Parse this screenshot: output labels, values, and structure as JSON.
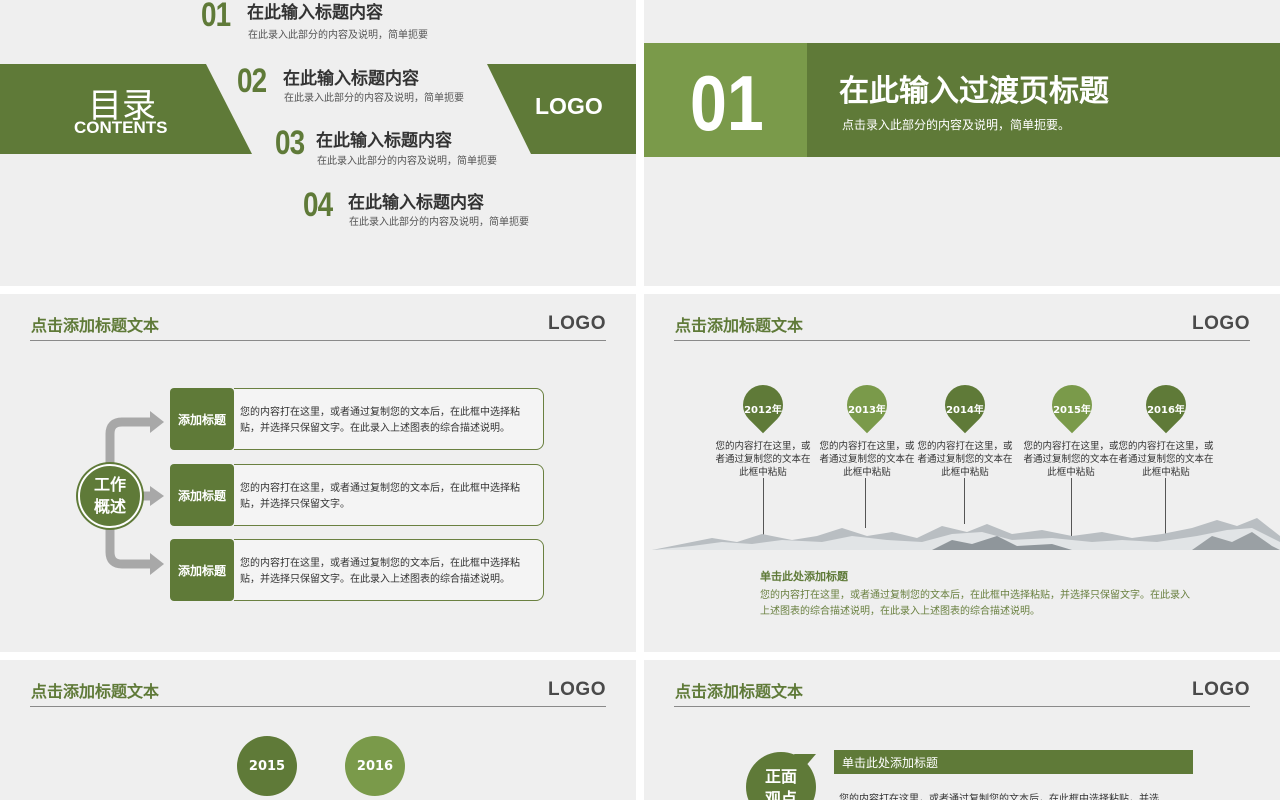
{
  "slide1": {
    "toc_main": "目录",
    "toc_sub": "CONTENTS",
    "logo": "LOGO",
    "items": [
      {
        "num": "01",
        "title": "在此输入标题内容",
        "desc": "在此录入此部分的内容及说明，简单扼要"
      },
      {
        "num": "02",
        "title": "在此输入标题内容",
        "desc": "在此录入此部分的内容及说明，简单扼要"
      },
      {
        "num": "03",
        "title": "在此输入标题内容",
        "desc": "在此录入此部分的内容及说明，简单扼要"
      },
      {
        "num": "04",
        "title": "在此输入标题内容",
        "desc": "在此录入此部分的内容及说明，简单扼要"
      }
    ]
  },
  "slide2": {
    "num": "01",
    "title": "在此输入过渡页标题",
    "desc": "点击录入此部分的内容及说明，简单扼要。"
  },
  "slide3": {
    "header": "点击添加标题文本",
    "logo": "LOGO",
    "center_line1": "工作",
    "center_line2": "概述",
    "rows": [
      {
        "label": "添加标题",
        "text": "您的内容打在这里，或者通过复制您的文本后，在此框中选择粘贴，并选择只保留文字。在此录入上述图表的综合描述说明。"
      },
      {
        "label": "添加标题",
        "text": "您的内容打在这里，或者通过复制您的文本后，在此框中选择粘贴，并选择只保留文字。"
      },
      {
        "label": "添加标题",
        "text": "您的内容打在这里，或者通过复制您的文本后，在此框中选择粘贴，并选择只保留文字。在此录入上述图表的综合描述说明。"
      }
    ]
  },
  "slide4": {
    "header": "点击添加标题文本",
    "logo": "LOGO",
    "years": [
      {
        "year": "2012年",
        "desc": "您的内容打在这里，或者通过复制您的文本在此框中粘贴"
      },
      {
        "year": "2013年",
        "desc": "您的内容打在这里，或者通过复制您的文本在此框中粘贴"
      },
      {
        "year": "2014年",
        "desc": "您的内容打在这里，或者通过复制您的文本在此框中粘贴"
      },
      {
        "year": "2015年",
        "desc": "您的内容打在这里，或者通过复制您的文本在此框中粘贴"
      },
      {
        "year": "2016年",
        "desc": "您的内容打在这里，或者通过复制您的文本在此框中粘贴"
      }
    ],
    "caption_title": "单击此处添加标题",
    "caption_text": "您的内容打在这里，或者通过复制您的文本后，在此框中选择粘贴，并选择只保留文字。在此录入上述图表的综合描述说明，在此录入上述图表的综合描述说明。"
  },
  "slide5": {
    "header": "点击添加标题文本",
    "logo": "LOGO",
    "year1": "2015",
    "year2": "2016"
  },
  "slide6": {
    "header": "点击添加标题文本",
    "logo": "LOGO",
    "bubble_line1": "正面",
    "bubble_line2": "观点",
    "bar_title": "单击此处添加标题",
    "text": "您的内容打在这里，或者通过复制您的文本后，在此框中选择粘贴，并选"
  },
  "colors": {
    "dark_green": "#5f7a38",
    "light_green": "#7a9a4a",
    "slide_bg": "#efefef"
  }
}
